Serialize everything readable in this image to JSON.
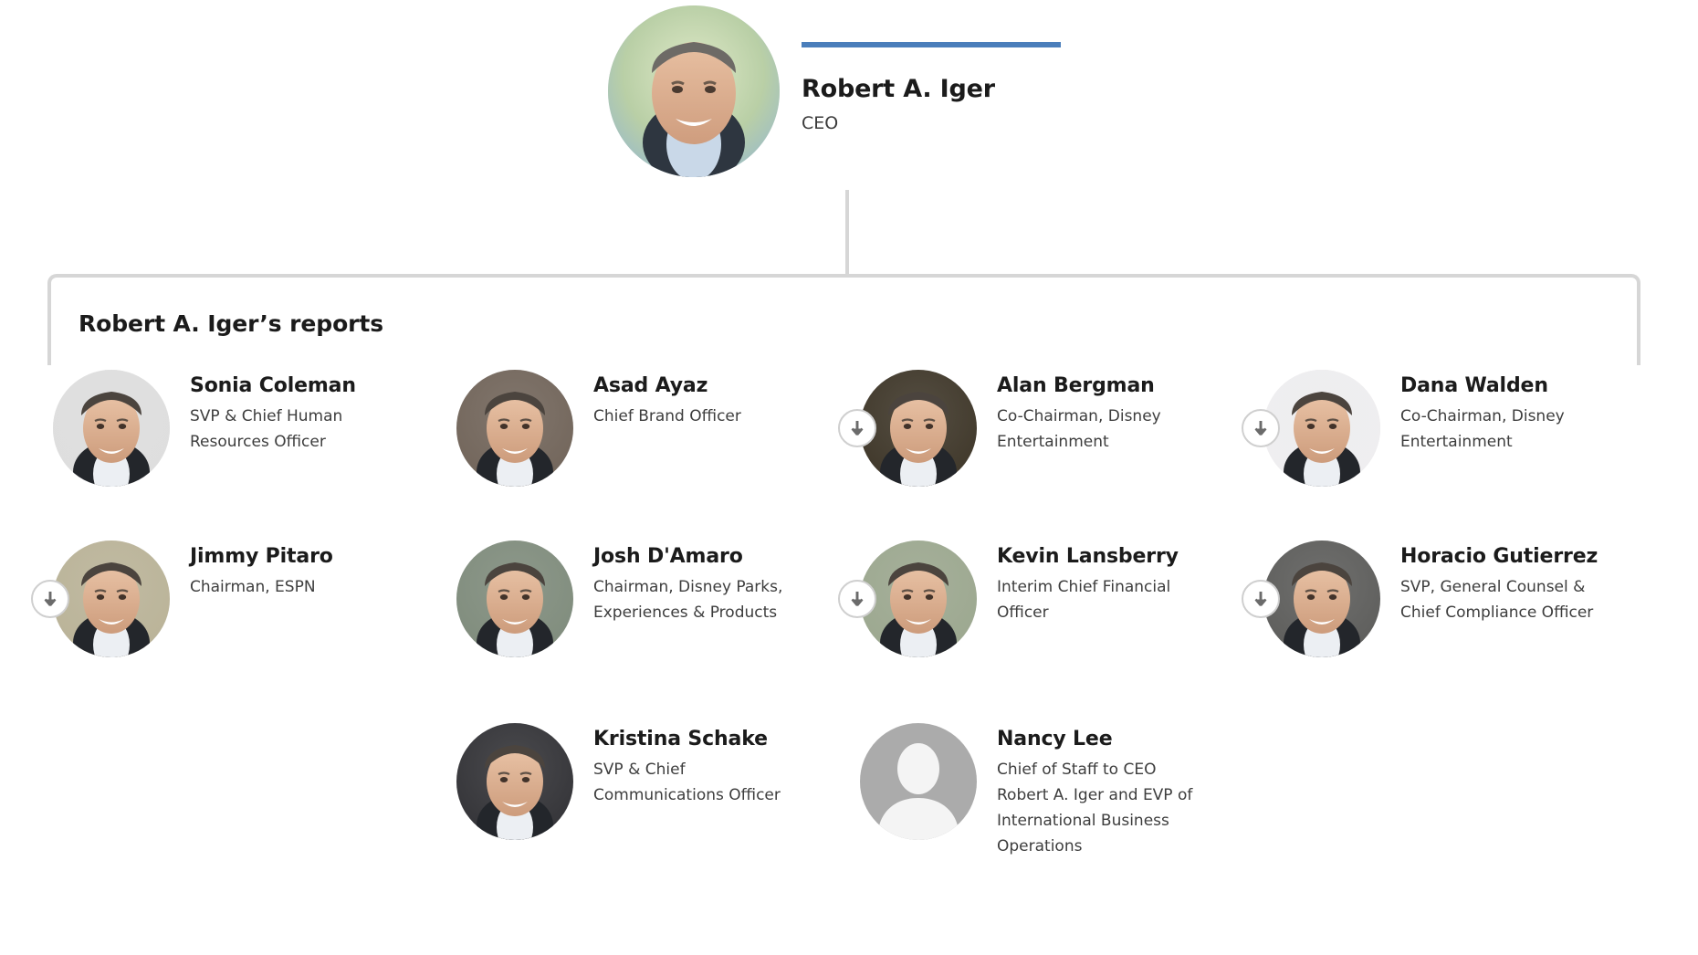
{
  "ceo": {
    "name": "Robert A. Iger",
    "title": "CEO",
    "accent_color": "#4a7ebb",
    "avatar_kind": "photo"
  },
  "section": {
    "heading": "Robert A. Iger’s reports",
    "bracket_color": "#d6d6d6"
  },
  "reports": [
    [
      {
        "name": "Sonia Coleman",
        "title": "SVP & Chief Human Resources Officer",
        "has_expand": false,
        "expand_icon": "arrow-down-icon",
        "avatar_kind": "photo",
        "avatar_tone": "#dedede"
      },
      {
        "name": "Asad Ayaz",
        "title": "Chief Brand Officer",
        "has_expand": false,
        "expand_icon": "arrow-down-icon",
        "avatar_kind": "photo",
        "avatar_tone": "#6f6257"
      },
      {
        "name": "Alan Bergman",
        "title": "Co-Chairman, Disney Entertainment",
        "has_expand": true,
        "expand_icon": "arrow-down-icon",
        "avatar_kind": "photo",
        "avatar_tone": "#3b3325"
      },
      {
        "name": "Dana Walden",
        "title": "Co-Chairman, Disney Entertainment",
        "has_expand": true,
        "expand_icon": "arrow-down-icon",
        "avatar_kind": "photo",
        "avatar_tone": "#efeef0"
      }
    ],
    [
      {
        "name": "Jimmy Pitaro",
        "title": "Chairman, ESPN",
        "has_expand": true,
        "expand_icon": "arrow-down-icon",
        "avatar_kind": "photo",
        "avatar_tone": "#b9b296"
      },
      {
        "name": "Josh D'Amaro",
        "title": "Chairman, Disney Parks, Experiences & Products",
        "has_expand": false,
        "expand_icon": "arrow-down-icon",
        "avatar_kind": "photo",
        "avatar_tone": "#7d8a7a"
      },
      {
        "name": "Kevin Lansberry",
        "title": "Interim Chief Financial Officer",
        "has_expand": true,
        "expand_icon": "arrow-down-icon",
        "avatar_kind": "photo",
        "avatar_tone": "#9aa68d"
      },
      {
        "name": "Horacio Gutierrez",
        "title": "SVP, General Counsel & Chief Compliance Officer",
        "has_expand": true,
        "expand_icon": "arrow-down-icon",
        "avatar_kind": "photo",
        "avatar_tone": "#5a5a58"
      }
    ],
    [
      {
        "name": "Kristina Schake",
        "title": "SVP & Chief Communications Officer",
        "has_expand": false,
        "expand_icon": "arrow-down-icon",
        "avatar_kind": "photo",
        "avatar_tone": "#2f2f33"
      },
      {
        "name": "Nancy Lee",
        "title": "Chief of Staff to CEO Robert A. Iger and EVP of International Business Operations",
        "has_expand": false,
        "expand_icon": "arrow-down-icon",
        "avatar_kind": "placeholder",
        "avatar_tone": "#ababab"
      }
    ]
  ]
}
